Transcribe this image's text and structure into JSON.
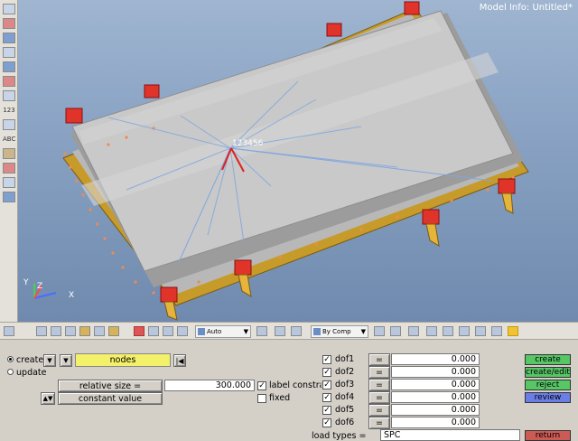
{
  "viewport": {
    "model_info": "Model Info: Untitled*",
    "node_label": "123456",
    "axes": {
      "y": "Y",
      "z": "Z",
      "x": "X"
    }
  },
  "toolbar": {
    "display_mode": "Auto",
    "color_by": "By Comp"
  },
  "panel": {
    "create_label": "create",
    "update_label": "update",
    "entity_type": "nodes",
    "relative_size_label": "relative size =",
    "relative_size_value": "300.000",
    "constant_value_label": "constant value",
    "label_constraints": "label constra",
    "fixed": "fixed",
    "eq": "=",
    "dofs": [
      {
        "label": "dof1",
        "value": "0.000"
      },
      {
        "label": "dof2",
        "value": "0.000"
      },
      {
        "label": "dof3",
        "value": "0.000"
      },
      {
        "label": "dof4",
        "value": "0.000"
      },
      {
        "label": "dof5",
        "value": "0.000"
      },
      {
        "label": "dof6",
        "value": "0.000"
      }
    ],
    "load_types_label": "load types =",
    "load_types_value": "SPC",
    "buttons": {
      "create": "create",
      "create_edit": "create/edit",
      "reject": "reject",
      "review": "review",
      "return": "return"
    },
    "colors": {
      "create": "#57c766",
      "create_edit": "#57c766",
      "reject": "#57c766",
      "review": "#6b7ee6",
      "return": "#cc5a55",
      "entity_highlight": "#f3f06a"
    }
  }
}
